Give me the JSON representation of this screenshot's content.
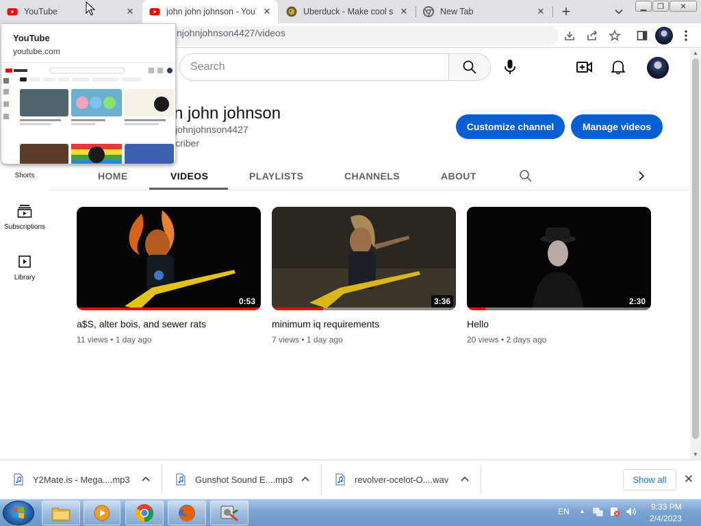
{
  "browser": {
    "tabs": [
      {
        "title": "YouTube",
        "favicon": "youtube-icon",
        "active": false
      },
      {
        "title": "john john johnson - YouT",
        "favicon": "youtube-icon",
        "active": true
      },
      {
        "title": "Uberduck - Make cool stu",
        "favicon": "uberduck-icon",
        "active": false
      },
      {
        "title": "New Tab",
        "favicon": "chrome-icon",
        "active": false
      }
    ],
    "new_tab_symbol": "+",
    "url": "njohnjohnson4427/videos"
  },
  "tab_preview": {
    "title": "YouTube",
    "domain": "youtube.com"
  },
  "youtube": {
    "search_placeholder": "Search",
    "channel": {
      "name": "n john johnson",
      "handle": "johnjohnson4427",
      "subscribers": "criber"
    },
    "buttons": {
      "customize": "Customize channel",
      "manage": "Manage videos"
    },
    "channel_tabs": [
      "HOME",
      "VIDEOS",
      "PLAYLISTS",
      "CHANNELS",
      "ABOUT"
    ],
    "active_tab": "VIDEOS",
    "sidebar": [
      {
        "label": "Shorts",
        "icon": "shorts-icon"
      },
      {
        "label": "Subscriptions",
        "icon": "subscriptions-icon"
      },
      {
        "label": "Library",
        "icon": "library-icon"
      }
    ],
    "videos": [
      {
        "title": "a$S, alter bois, and sewer rats",
        "views": "11 views",
        "age": "1 day ago",
        "duration": "0:53",
        "watched_fraction": 1.0
      },
      {
        "title": "minimum iq requirements",
        "views": "7 views",
        "age": "1 day ago",
        "duration": "3:36",
        "watched_fraction": 0.28
      },
      {
        "title": "Hello",
        "views": "20 views",
        "age": "2 days ago",
        "duration": "2:30",
        "watched_fraction": 0.1
      }
    ],
    "meta_separator": "•",
    "colors": {
      "brand_red": "#ff0000",
      "button_blue": "#065fd4"
    }
  },
  "downloads": {
    "items": [
      {
        "name": "Y2Mate.is - Mega....mp3"
      },
      {
        "name": "Gunshot Sound E....mp3"
      },
      {
        "name": "revolver-ocelot-O....wav"
      }
    ],
    "show_all": "Show all",
    "close_symbol": "✕"
  },
  "taskbar": {
    "language": "EN",
    "time": "9:33 PM",
    "date": "2/4/2023",
    "apps": [
      "explorer-icon",
      "media-player-icon",
      "chrome-icon",
      "firefox-icon",
      "media-codec-icon"
    ]
  }
}
